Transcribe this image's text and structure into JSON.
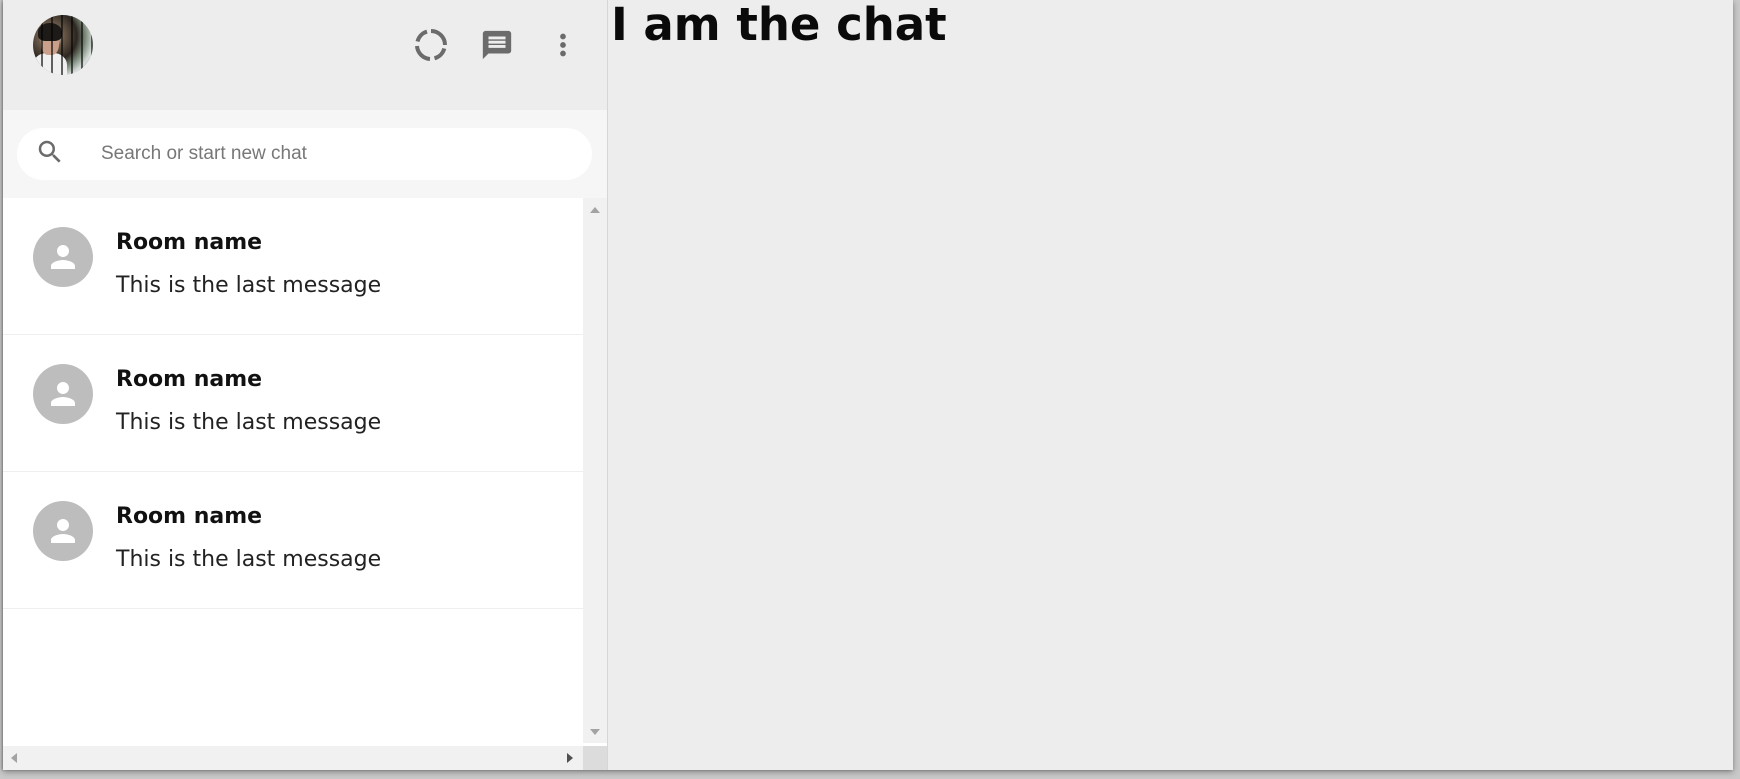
{
  "sidebar": {
    "header": {
      "icons": [
        "status-icon",
        "new-chat-icon",
        "more-vert-icon"
      ]
    },
    "search": {
      "placeholder": "Search or start new chat"
    },
    "chats": [
      {
        "room_name": "Room name",
        "last_message": "This is the last message"
      },
      {
        "room_name": "Room name",
        "last_message": "This is the last message"
      },
      {
        "room_name": "Room name",
        "last_message": "This is the last message"
      }
    ]
  },
  "chat": {
    "title": "I am the chat"
  },
  "colors": {
    "header_bg": "#ededed",
    "avatar_placeholder": "#bdbdbd",
    "icon_gray": "#6b6b6b"
  }
}
